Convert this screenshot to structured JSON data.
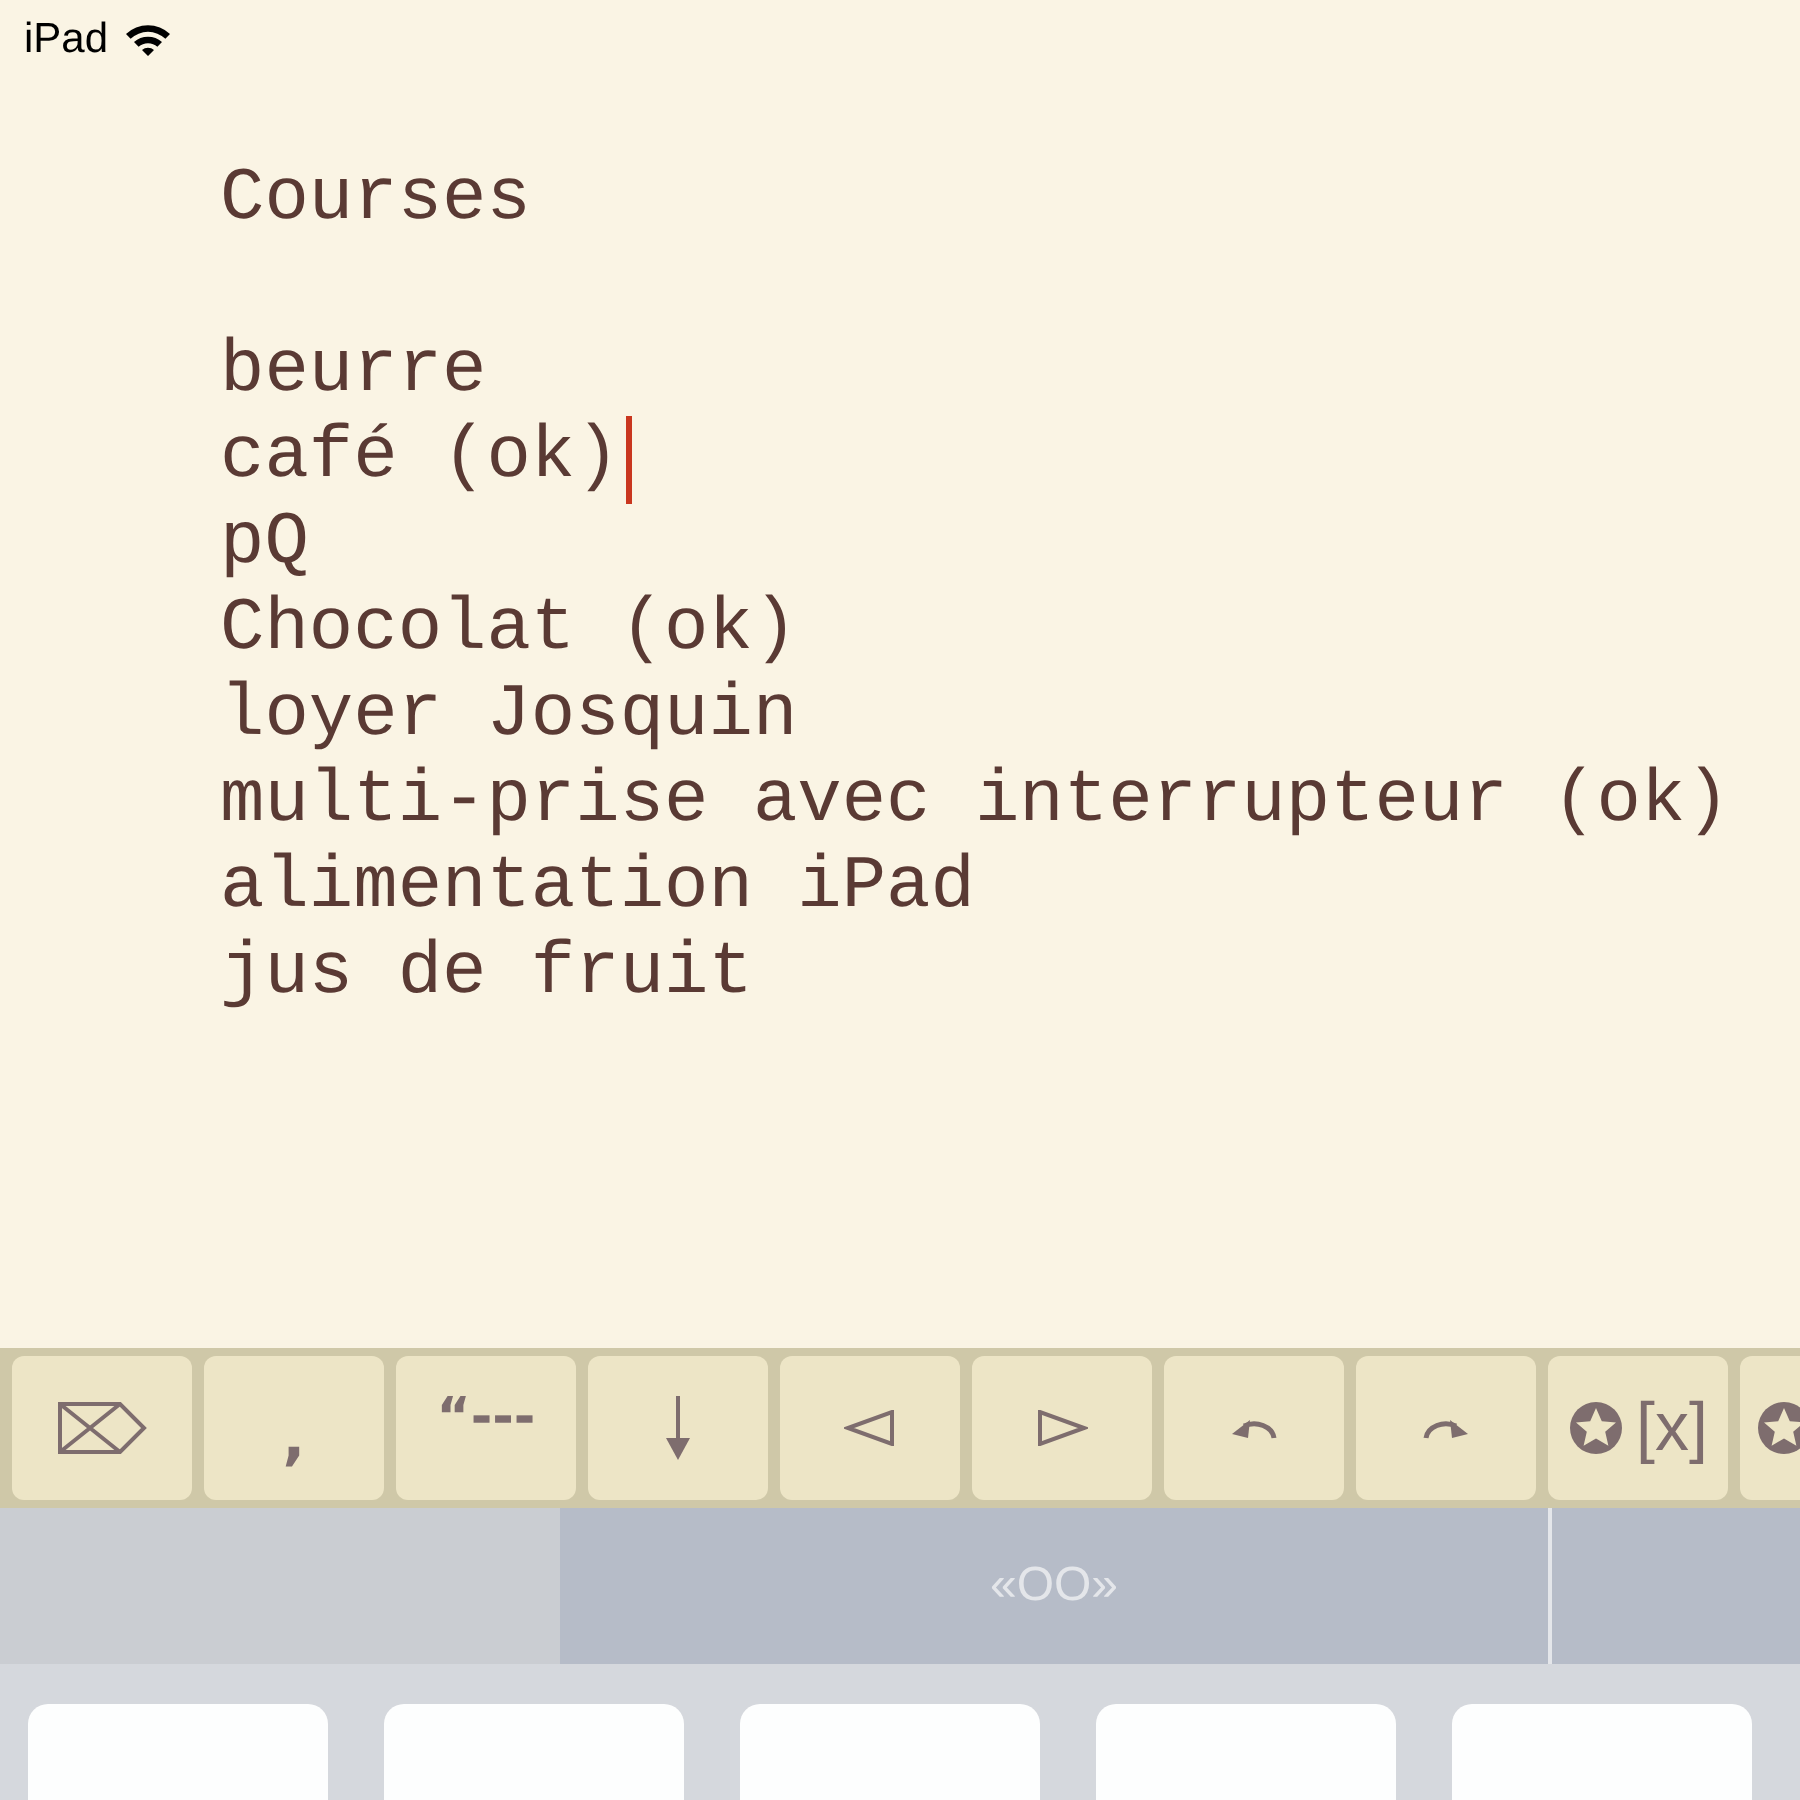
{
  "status_bar": {
    "device": "iPad",
    "wifi": true
  },
  "document": {
    "lines": [
      {
        "text": "Courses",
        "cursor": false
      },
      {
        "cursor": false
      },
      {
        "text": "beurre",
        "cursor": false
      },
      {
        "text": "café (ok)",
        "cursor": true
      },
      {
        "text": "pQ",
        "cursor": false
      },
      {
        "text": "Chocolat (ok)",
        "cursor": false
      },
      {
        "text": "loyer Josquin",
        "cursor": false
      },
      {
        "text": "multi-prise avec interrupteur (ok)",
        "cursor": false
      },
      {
        "text": "alimentation iPad",
        "cursor": false
      },
      {
        "text": "jus de fruit",
        "cursor": false
      }
    ]
  },
  "toolbar": {
    "keys": [
      {
        "kind": "delete"
      },
      {
        "kind": "text",
        "label": ","
      },
      {
        "kind": "text",
        "label": "“---"
      },
      {
        "kind": "down"
      },
      {
        "kind": "left"
      },
      {
        "kind": "right"
      },
      {
        "kind": "undo"
      },
      {
        "kind": "redo"
      },
      {
        "kind": "star",
        "label": "[x]"
      },
      {
        "kind": "star"
      }
    ]
  },
  "suggestion_bar": {
    "suggestion": "«OO»"
  }
}
